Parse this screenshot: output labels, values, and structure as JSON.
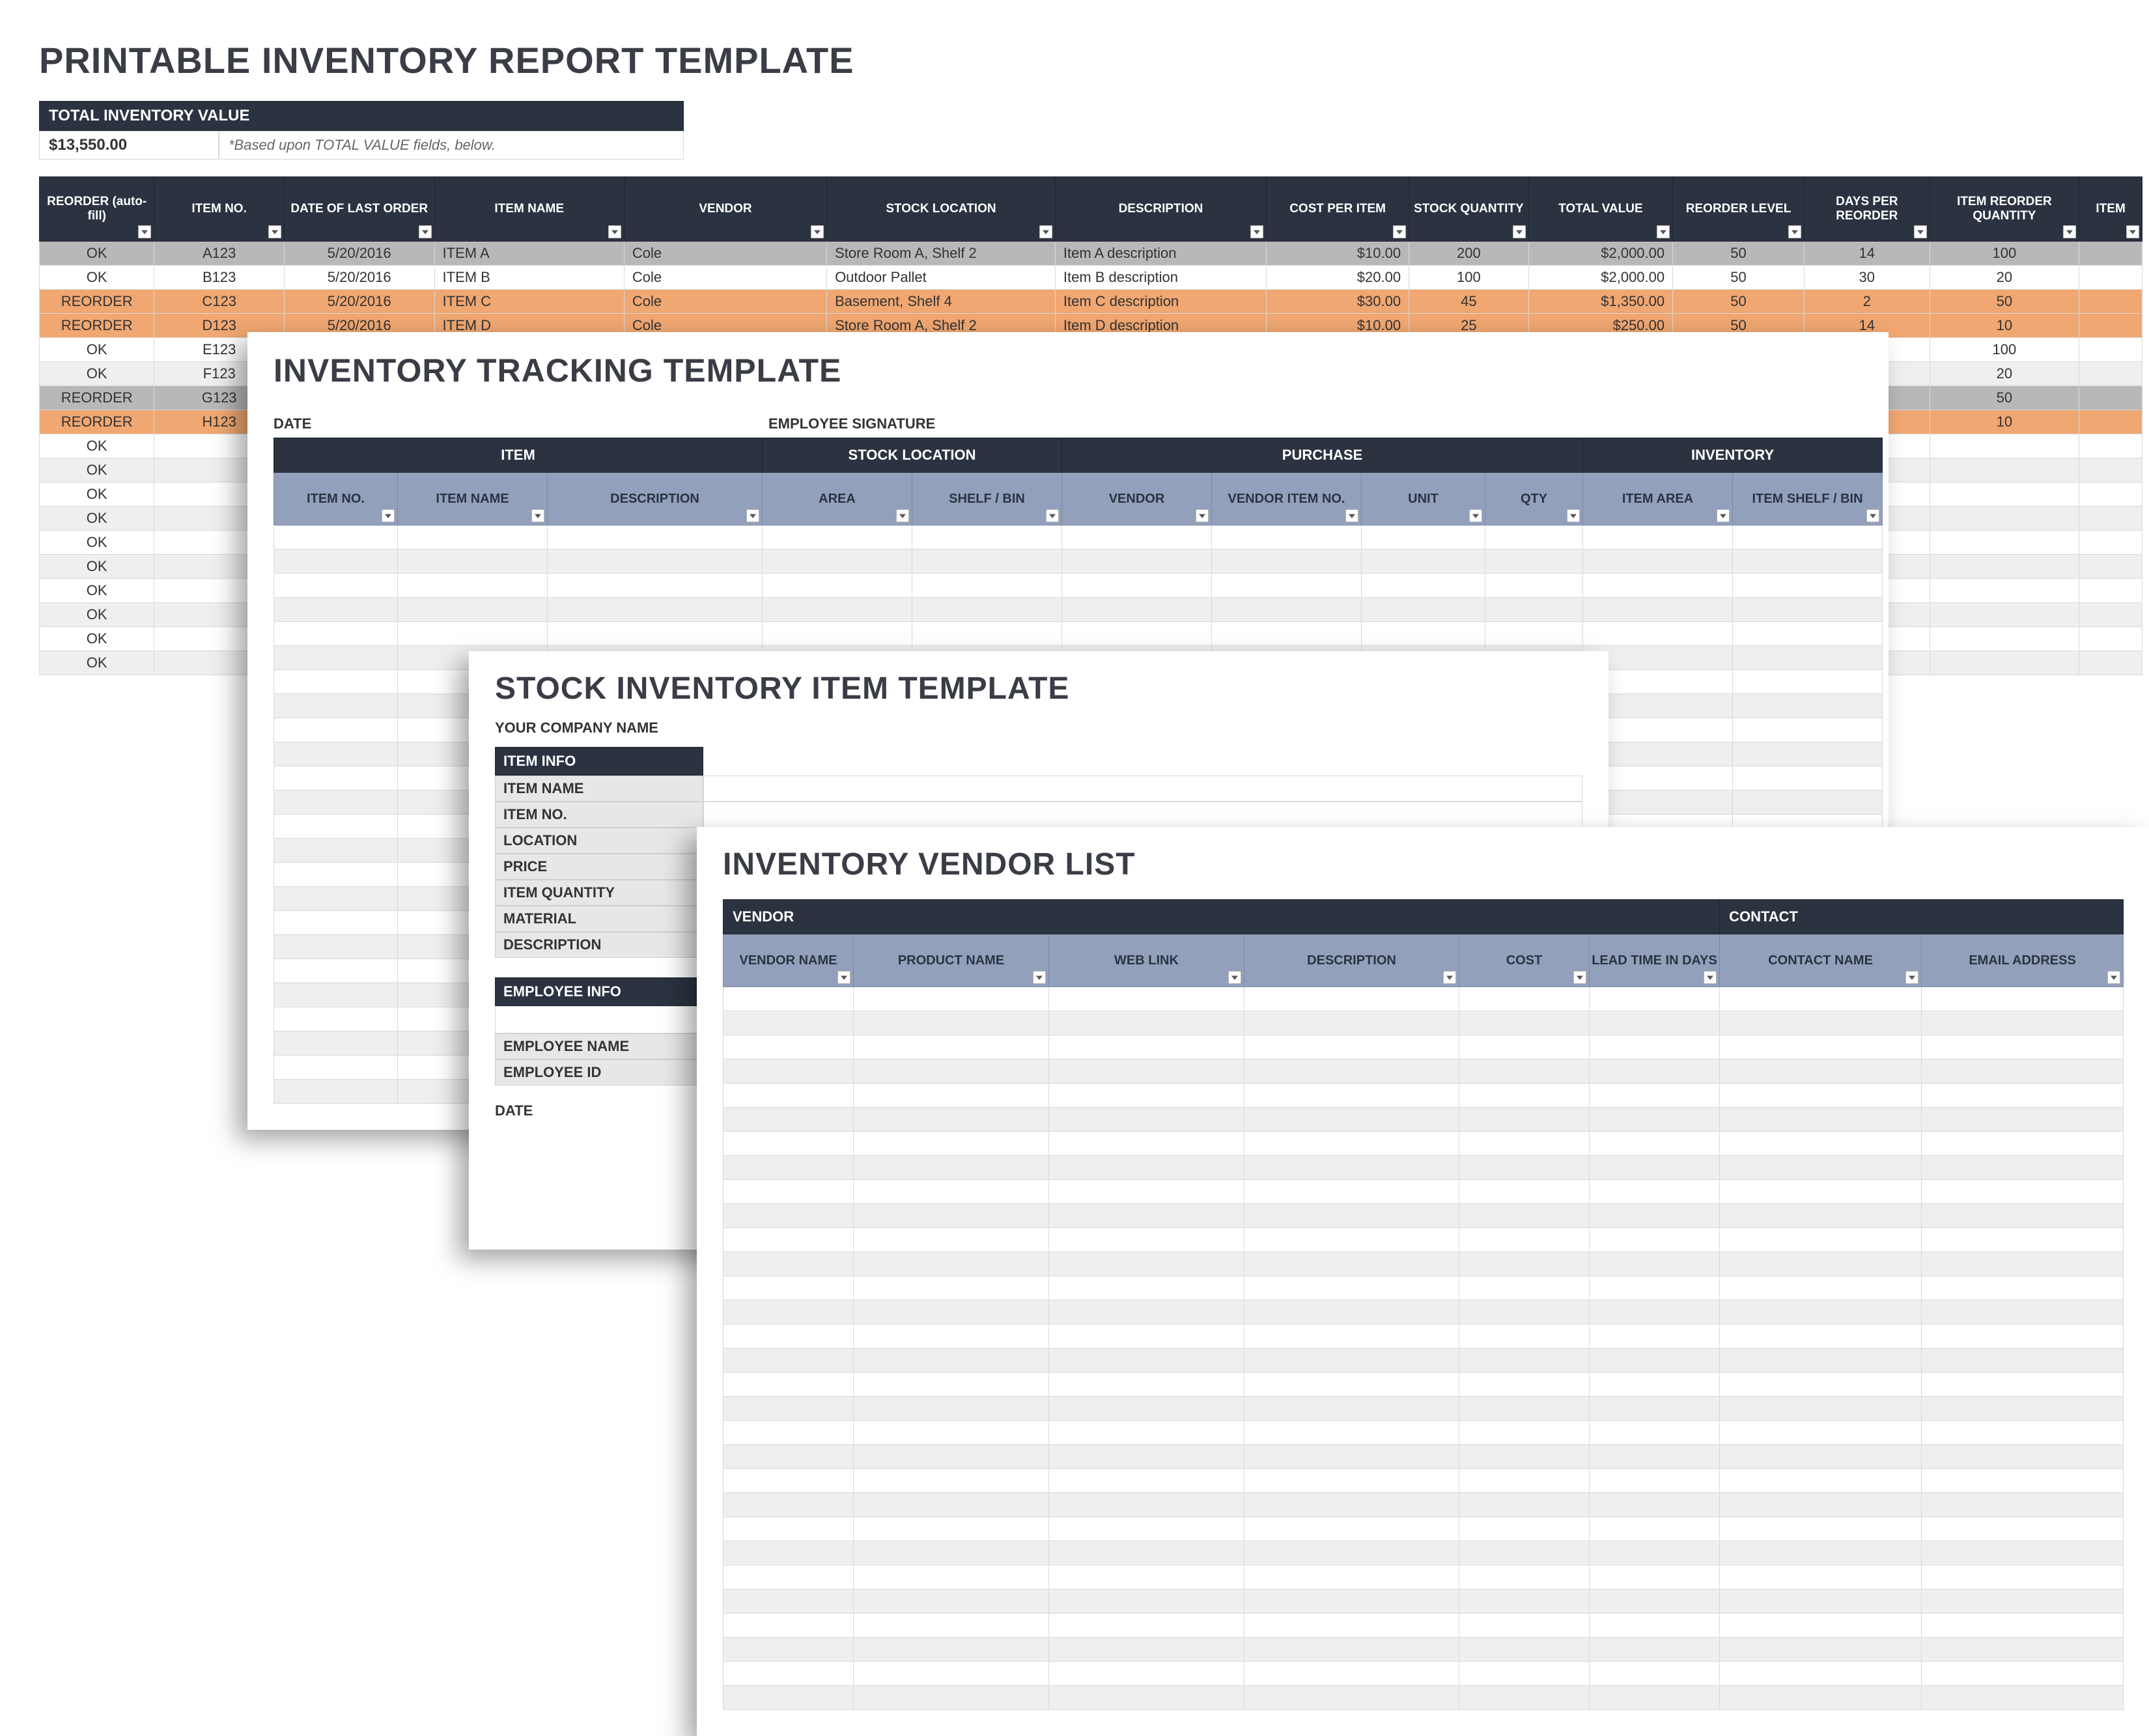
{
  "report": {
    "title": "PRINTABLE INVENTORY REPORT TEMPLATE",
    "total_label": "TOTAL INVENTORY VALUE",
    "total_value": "$13,550.00",
    "total_note": "*Based upon TOTAL VALUE fields, below.",
    "columns": [
      "REORDER (auto-fill)",
      "ITEM NO.",
      "DATE OF LAST ORDER",
      "ITEM NAME",
      "VENDOR",
      "STOCK LOCATION",
      "DESCRIPTION",
      "COST PER ITEM",
      "STOCK QUANTITY",
      "TOTAL VALUE",
      "REORDER LEVEL",
      "DAYS PER REORDER",
      "ITEM REORDER QUANTITY",
      "ITEM"
    ],
    "rows": [
      {
        "state": "sel",
        "reorder": "OK",
        "item_no": "A123",
        "date": "5/20/2016",
        "name": "ITEM A",
        "vendor": "Cole",
        "loc": "Store Room A, Shelf 2",
        "desc": "Item A description",
        "cost": "$10.00",
        "qty": "200",
        "total": "$2,000.00",
        "rl": "50",
        "days": "14",
        "rq": "100"
      },
      {
        "state": "",
        "reorder": "OK",
        "item_no": "B123",
        "date": "5/20/2016",
        "name": "ITEM B",
        "vendor": "Cole",
        "loc": "Outdoor Pallet",
        "desc": "Item B description",
        "cost": "$20.00",
        "qty": "100",
        "total": "$2,000.00",
        "rl": "50",
        "days": "30",
        "rq": "20"
      },
      {
        "state": "warn",
        "reorder": "REORDER",
        "item_no": "C123",
        "date": "5/20/2016",
        "name": "ITEM C",
        "vendor": "Cole",
        "loc": "Basement, Shelf 4",
        "desc": "Item C description",
        "cost": "$30.00",
        "qty": "45",
        "total": "$1,350.00",
        "rl": "50",
        "days": "2",
        "rq": "50"
      },
      {
        "state": "warn",
        "reorder": "REORDER",
        "item_no": "D123",
        "date": "5/20/2016",
        "name": "ITEM D",
        "vendor": "Cole",
        "loc": "Store Room A, Shelf 2",
        "desc": "Item D description",
        "cost": "$10.00",
        "qty": "25",
        "total": "$250.00",
        "rl": "50",
        "days": "14",
        "rq": "10"
      },
      {
        "state": "",
        "reorder": "OK",
        "item_no": "E123",
        "rq": "100"
      },
      {
        "state": "alt",
        "reorder": "OK",
        "item_no": "F123",
        "rq": "20"
      },
      {
        "state": "sel",
        "reorder": "REORDER",
        "item_no": "G123",
        "rq": "50"
      },
      {
        "state": "warn",
        "reorder": "REORDER",
        "item_no": "H123",
        "rq": "10"
      },
      {
        "state": "",
        "reorder": "OK"
      },
      {
        "state": "alt",
        "reorder": "OK"
      },
      {
        "state": "",
        "reorder": "OK"
      },
      {
        "state": "alt",
        "reorder": "OK"
      },
      {
        "state": "",
        "reorder": "OK"
      },
      {
        "state": "alt",
        "reorder": "OK"
      },
      {
        "state": "",
        "reorder": "OK"
      },
      {
        "state": "alt",
        "reorder": "OK"
      },
      {
        "state": "",
        "reorder": "OK"
      },
      {
        "state": "alt",
        "reorder": "OK"
      }
    ]
  },
  "tracking": {
    "title": "INVENTORY TRACKING TEMPLATE",
    "date_label": "DATE",
    "sig_label": "EMPLOYEE SIGNATURE",
    "groups": [
      "ITEM",
      "STOCK LOCATION",
      "PURCHASE",
      "INVENTORY"
    ],
    "subs": [
      "ITEM NO.",
      "ITEM NAME",
      "DESCRIPTION",
      "AREA",
      "SHELF / BIN",
      "VENDOR",
      "VENDOR ITEM NO.",
      "UNIT",
      "QTY",
      "ITEM AREA",
      "ITEM SHELF / BIN"
    ],
    "blank_rows": 24
  },
  "stock": {
    "title": "STOCK INVENTORY ITEM TEMPLATE",
    "company": "YOUR COMPANY NAME",
    "info_head": "ITEM INFO",
    "info_rows": [
      "ITEM NAME",
      "ITEM NO.",
      "LOCATION",
      "PRICE",
      "ITEM QUANTITY",
      "MATERIAL",
      "DESCRIPTION"
    ],
    "emp_head": "EMPLOYEE INFO",
    "emp_rows": [
      "EMPLOYEE NAME",
      "EMPLOYEE ID"
    ],
    "date_label": "DATE"
  },
  "vendor": {
    "title": "INVENTORY VENDOR LIST",
    "groups": [
      "VENDOR",
      "CONTACT"
    ],
    "subs": [
      "VENDOR NAME",
      "PRODUCT NAME",
      "WEB LINK",
      "DESCRIPTION",
      "COST",
      "LEAD TIME IN DAYS",
      "CONTACT NAME",
      "EMAIL ADDRESS"
    ],
    "blank_rows": 30
  }
}
